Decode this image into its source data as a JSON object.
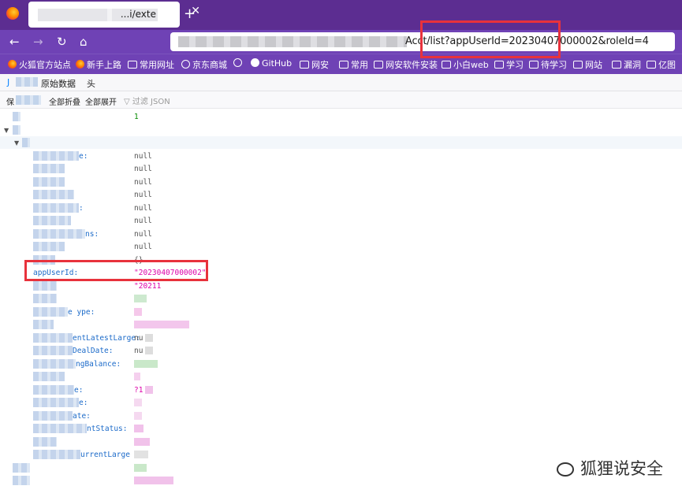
{
  "browser": {
    "tab": {
      "title_visible": "...i/exte",
      "close_glyph": "✕",
      "new_tab_glyph": "+"
    },
    "nav": {
      "back": "←",
      "forward": "→",
      "reload": "↻",
      "home": "⌂"
    },
    "url": {
      "visible_text": "Acct/list?appUserId=20230407000002&roleId=4"
    },
    "bookmarks": [
      {
        "label": "火狐官方站点",
        "icon": "firefox-icon"
      },
      {
        "label": "新手上路",
        "icon": "firefox-icon"
      },
      {
        "label": "常用网址",
        "icon": "folder-icon"
      },
      {
        "label": "京东商城",
        "icon": "globe-icon"
      },
      {
        "label": "",
        "icon": "globe-icon"
      },
      {
        "label": "GitHub",
        "icon": "github-icon"
      },
      {
        "label": "网安",
        "icon": "folder-icon"
      },
      {
        "label": "常用",
        "icon": "folder-icon"
      },
      {
        "label": "网安软件安装",
        "icon": "folder-icon"
      },
      {
        "label": "小白web",
        "icon": "folder-icon"
      },
      {
        "label": "学习",
        "icon": "folder-icon"
      },
      {
        "label": "待学习",
        "icon": "folder-icon"
      },
      {
        "label": "网站",
        "icon": "folder-icon"
      },
      {
        "label": "漏洞",
        "icon": "folder-icon"
      },
      {
        "label": "亿图",
        "icon": "folder-icon"
      }
    ]
  },
  "viewer": {
    "tabs": [
      "J",
      "原始数据",
      "头"
    ],
    "toolbar": {
      "save": "保",
      "collapse_all": "全部折叠",
      "expand_all": "全部展开",
      "filter_placeholder": "过滤 JSON"
    }
  },
  "json_rows": [
    {
      "key": "",
      "value": "1",
      "type": "num"
    },
    {
      "key": "",
      "value": "",
      "type": "obj"
    },
    {
      "key": "",
      "value": "",
      "type": "obj"
    },
    {
      "key": "e:",
      "value": "null",
      "type": "null"
    },
    {
      "key": "",
      "value": "null",
      "type": "null"
    },
    {
      "key": "",
      "value": "null",
      "type": "null"
    },
    {
      "key": "",
      "value": "null",
      "type": "null"
    },
    {
      "key": ":",
      "value": "null",
      "type": "null"
    },
    {
      "key": "",
      "value": "null",
      "type": "null"
    },
    {
      "key": "ns:",
      "value": "null",
      "type": "null"
    },
    {
      "key": "",
      "value": "null",
      "type": "null"
    },
    {
      "key": "",
      "value": "{}",
      "type": "obj"
    },
    {
      "key": "appUserId:",
      "value": "\"20230407000002\"",
      "type": "str"
    },
    {
      "key": "",
      "value": "\"20211",
      "type": "str"
    },
    {
      "key": "",
      "value": "",
      "type": "blur"
    },
    {
      "key": "e   ype:",
      "value": "",
      "type": "blur"
    },
    {
      "key": "",
      "value": "",
      "type": "blur"
    },
    {
      "key": "entLatestLarge:",
      "value": "nu",
      "type": "null"
    },
    {
      "key": "DealDate:",
      "value": "nu",
      "type": "null"
    },
    {
      "key": "ngBalance:",
      "value": "",
      "type": "blur"
    },
    {
      "key": "",
      "value": "",
      "type": "blur"
    },
    {
      "key": "e:",
      "value": "?1",
      "type": "str"
    },
    {
      "key": "e:",
      "value": "",
      "type": "blur"
    },
    {
      "key": "ate:",
      "value": "",
      "type": "blur"
    },
    {
      "key": "ntStatus:",
      "value": "",
      "type": "blur"
    },
    {
      "key": "",
      "value": "",
      "type": "blur"
    },
    {
      "key": "urrentLarge",
      "value": "",
      "type": "blur"
    },
    {
      "key": "",
      "value": "",
      "type": "blur"
    },
    {
      "key": "",
      "value": "",
      "type": "blur"
    }
  ],
  "watermark": {
    "text": "狐狸说安全"
  },
  "colors": {
    "tab_strip": "#5c2d91",
    "toolbar": "#6f42b5",
    "highlight": "#e8323c",
    "string": "#dd00a9",
    "number": "#058b00",
    "key": "#1b6ac9"
  }
}
